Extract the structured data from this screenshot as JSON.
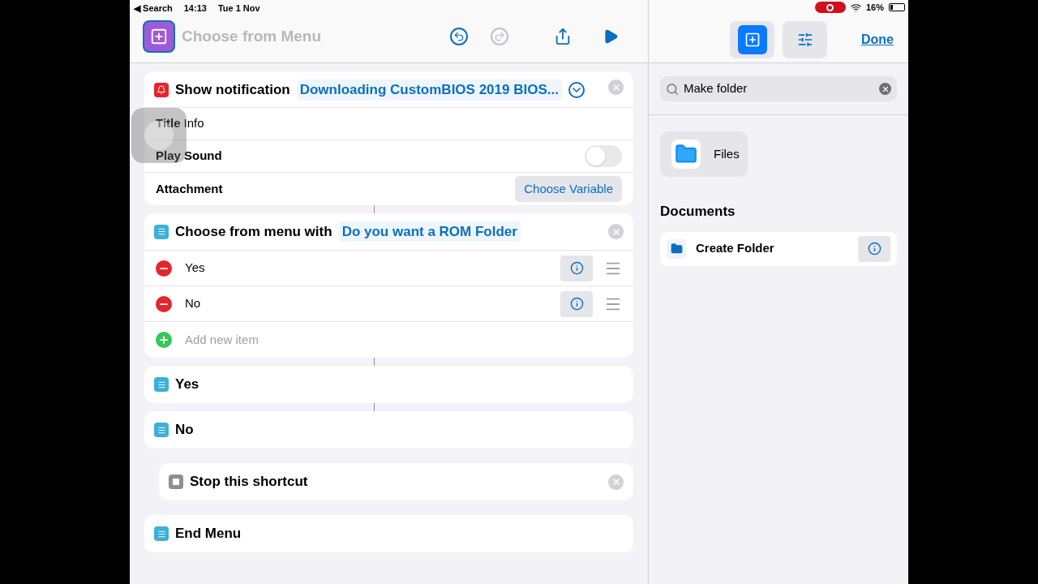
{
  "status_bar": {
    "back": "◀ Search",
    "time": "14:13",
    "date": "Tue 1 Nov",
    "battery": "16%"
  },
  "editor": {
    "title": "Choose from Menu",
    "redo_disabled": true
  },
  "actions": [
    {
      "kind": "notification",
      "title": "Show notification",
      "token": "Downloading CustomBIOS 2019 BIOS...",
      "params": [
        {
          "kind": "text",
          "label": "Title",
          "value": "Info"
        },
        {
          "kind": "toggle",
          "label": "Play Sound",
          "on": false
        },
        {
          "kind": "variable",
          "label": "Attachment",
          "value": "Choose Variable"
        }
      ]
    },
    {
      "kind": "menu",
      "title": "Choose from menu with",
      "token": "Do you want a ROM Folder",
      "items": [
        "Yes",
        "No"
      ],
      "add": "Add new item"
    },
    {
      "kind": "case",
      "title": "Yes"
    },
    {
      "kind": "case",
      "title": "No"
    },
    {
      "kind": "stop",
      "title": "Stop this shortcut"
    },
    {
      "kind": "case",
      "title": "End Menu"
    }
  ],
  "panel": {
    "tabs": [
      {
        "kind": "actions",
        "selected": true
      },
      {
        "kind": "settings",
        "selected": false
      }
    ],
    "done": "Done",
    "search": "Make folder",
    "app": "Files",
    "section": "Documents",
    "results": [
      "Create Folder"
    ]
  }
}
